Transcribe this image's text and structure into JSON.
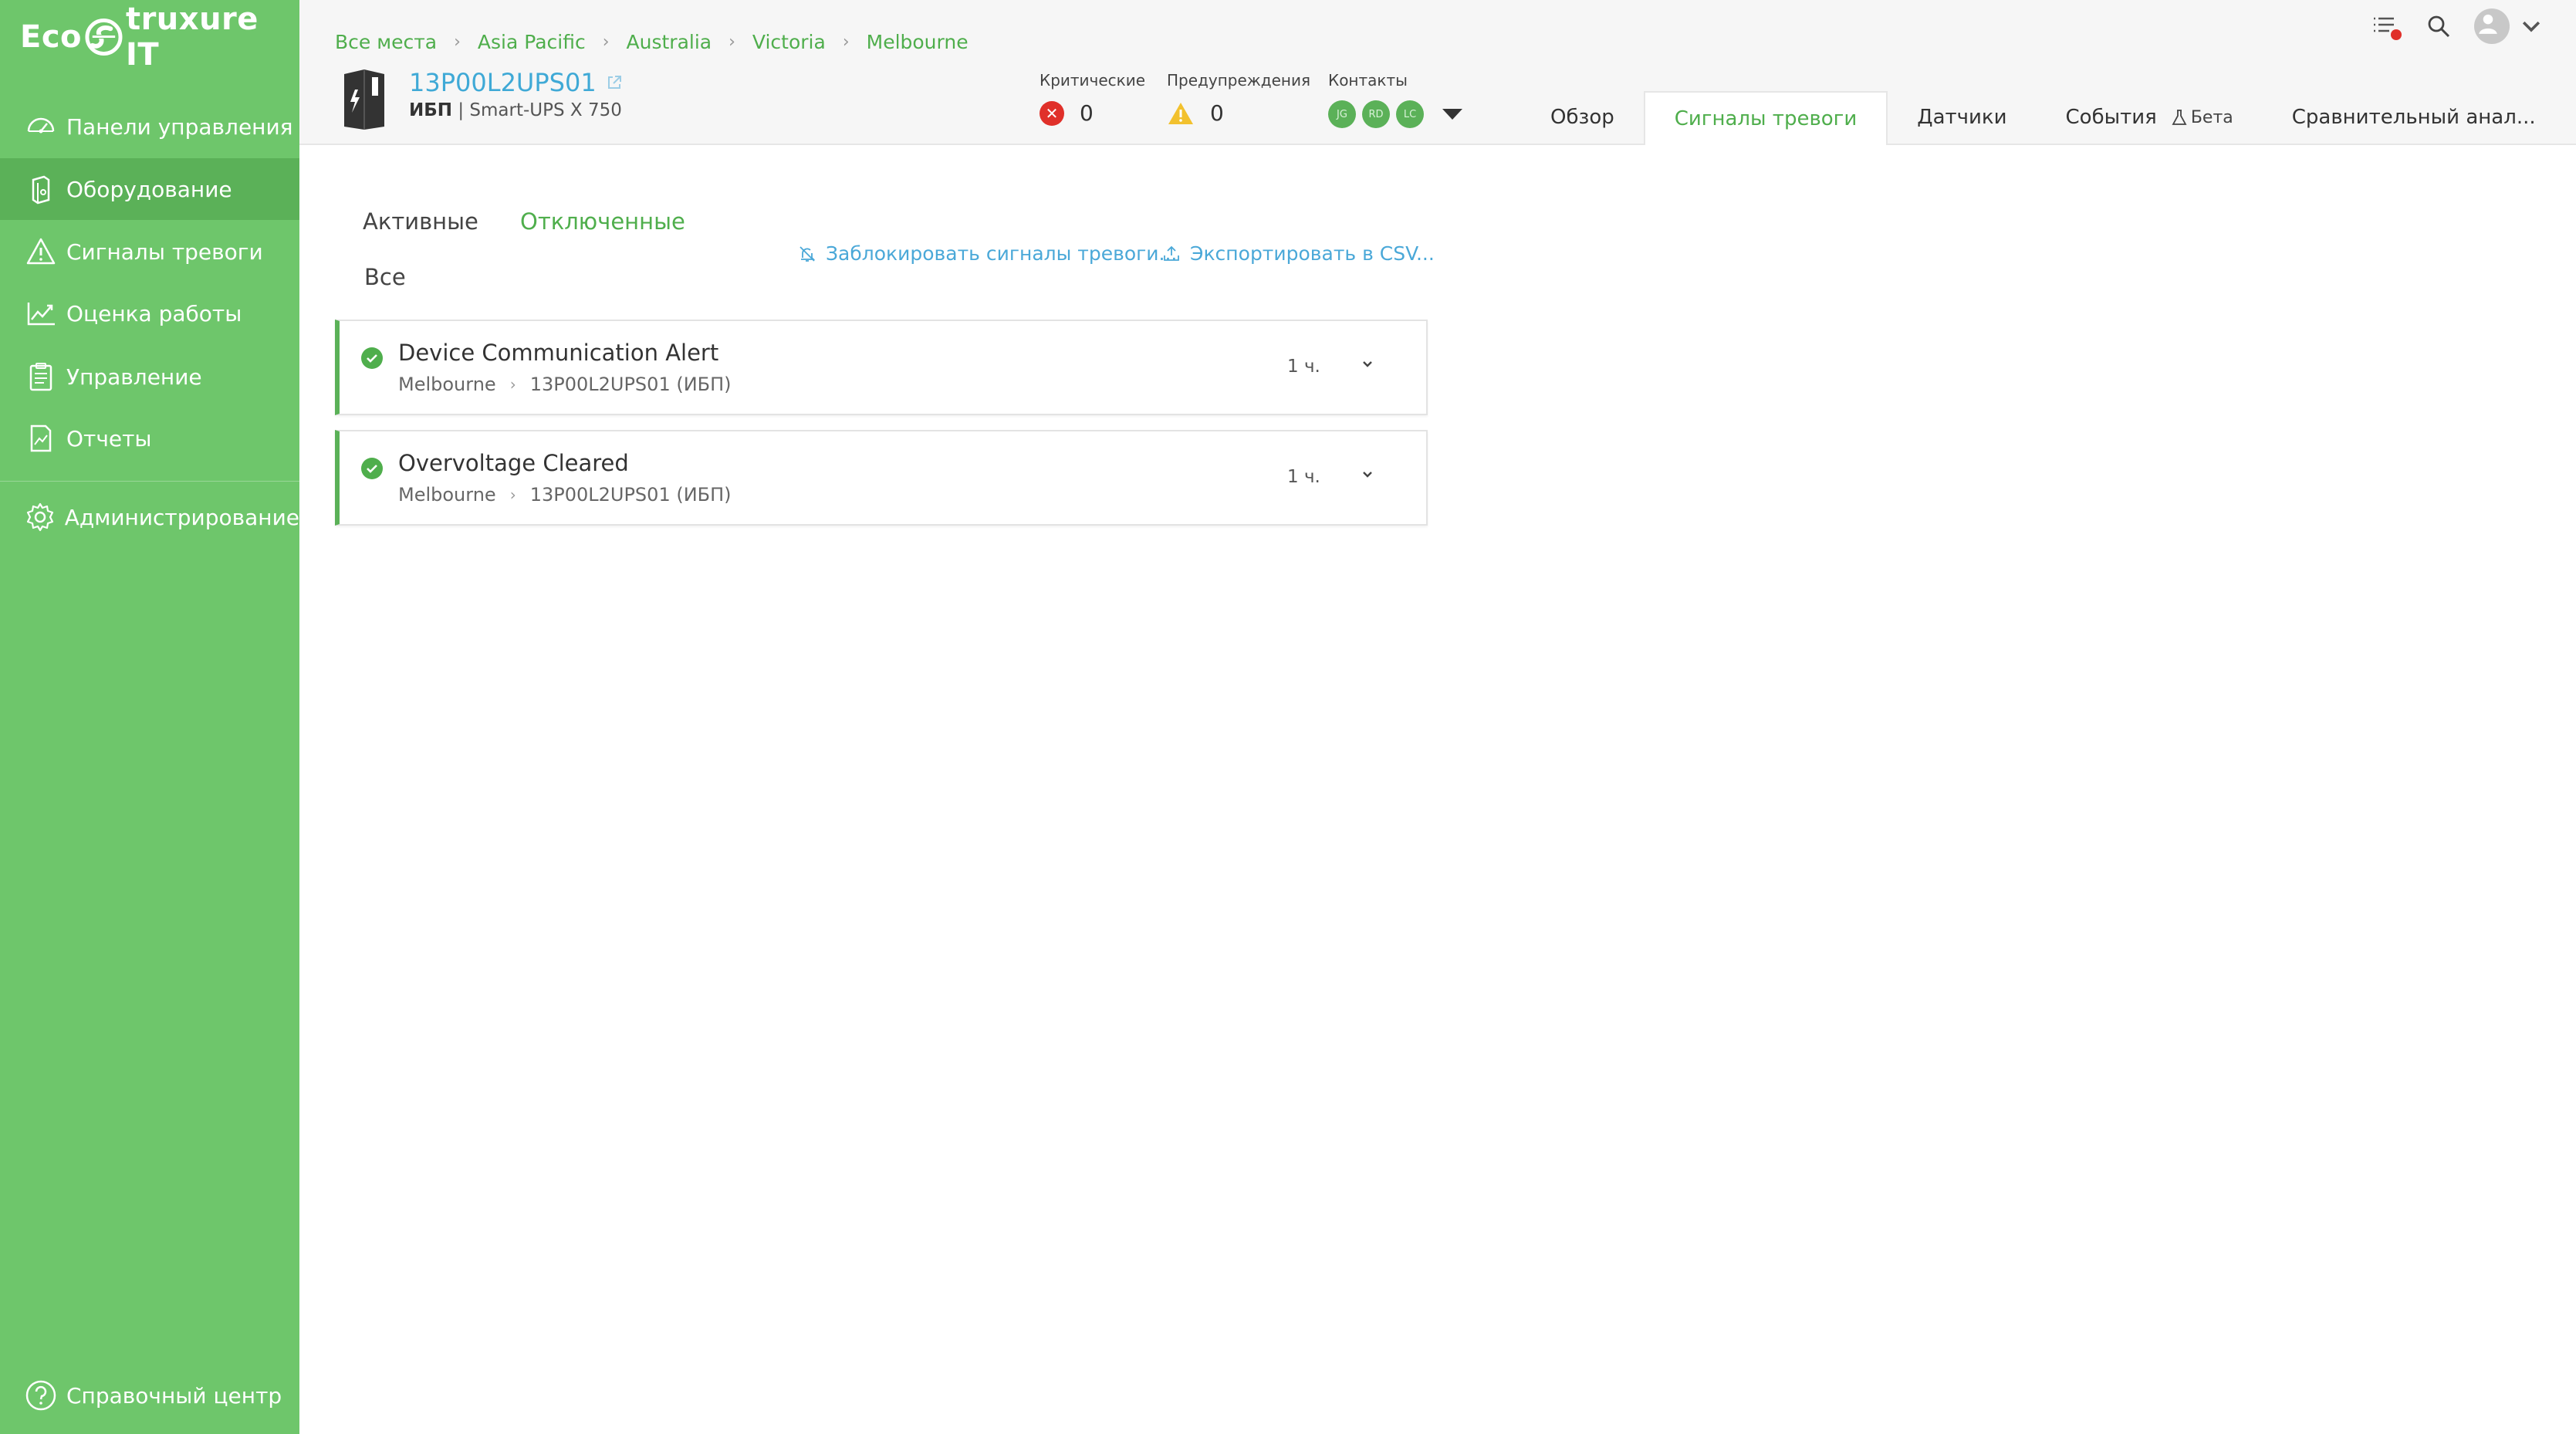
{
  "brand": {
    "logo_left": "Eco",
    "logo_right": "truxure IT"
  },
  "sidebar": {
    "items": [
      {
        "label": "Панели управления",
        "icon": "dashboard-icon"
      },
      {
        "label": "Оборудование",
        "icon": "equipment-icon",
        "active": true
      },
      {
        "label": "Сигналы тревоги",
        "icon": "alarm-icon"
      },
      {
        "label": "Оценка работы",
        "icon": "performance-icon"
      },
      {
        "label": "Управление",
        "icon": "clipboard-icon"
      },
      {
        "label": "Отчеты",
        "icon": "report-icon"
      },
      {
        "label": "Администрирование",
        "icon": "gear-icon"
      }
    ],
    "help_label": "Справочный центр"
  },
  "breadcrumb": [
    "Все места",
    "Asia Pacific",
    "Australia",
    "Victoria",
    "Melbourne"
  ],
  "device": {
    "name": "13P00L2UPS01",
    "type": "ИБП",
    "model": "Smart-UPS X 750"
  },
  "stats": {
    "critical_label": "Критические",
    "critical_value": "0",
    "warnings_label": "Предупреждения",
    "warnings_value": "0",
    "contacts_label": "Контакты",
    "contacts": [
      "JG",
      "RD",
      "LC"
    ]
  },
  "tabs": [
    {
      "label": "Обзор"
    },
    {
      "label": "Сигналы тревоги",
      "active": true
    },
    {
      "label": "Датчики"
    },
    {
      "label": "События",
      "beta": "Бета"
    },
    {
      "label": "Сравнительный анал..."
    }
  ],
  "subtabs": {
    "active": "Активные",
    "cleared": "Отключенные",
    "all": "Все"
  },
  "actions": {
    "suppress": "Заблокировать сигналы тревоги...",
    "export": "Экспортировать в CSV..."
  },
  "alarms": [
    {
      "title": "Device Communication Alert",
      "location": "Melbourne",
      "device": "13P00L2UPS01 (ИБП)",
      "time": "1 ч."
    },
    {
      "title": "Overvoltage Cleared",
      "location": "Melbourne",
      "device": "13P00L2UPS01 (ИБП)",
      "time": "1 ч."
    }
  ],
  "colors": {
    "brand_green": "#6ec66b",
    "active_green": "#4fae4c",
    "link_blue": "#3fa9d6",
    "critical_red": "#e0302a",
    "warning_yellow": "#f2c12e"
  }
}
